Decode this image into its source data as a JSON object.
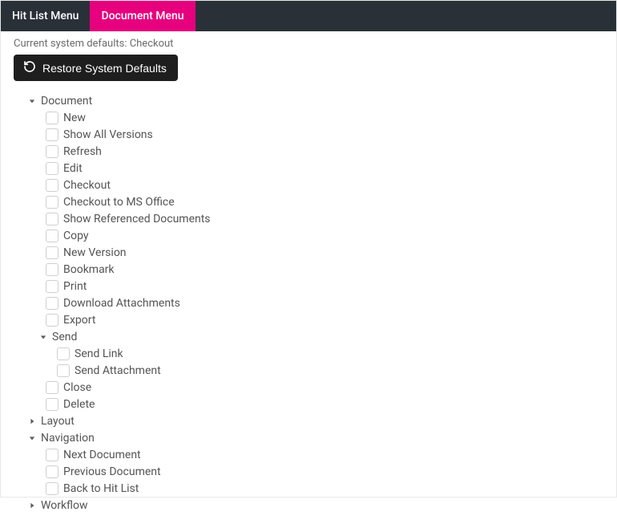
{
  "tabs": {
    "hitlist": "Hit List Menu",
    "document": "Document Menu"
  },
  "defaults_label": "Current system defaults: Checkout",
  "restore_button": "Restore System Defaults",
  "tree": {
    "document": {
      "label": "Document",
      "items": {
        "new": "New",
        "show_all_versions": "Show All Versions",
        "refresh": "Refresh",
        "edit": "Edit",
        "checkout": "Checkout",
        "checkout_ms_office": "Checkout to MS Office",
        "show_referenced": "Show Referenced Documents",
        "copy": "Copy",
        "new_version": "New Version",
        "bookmark": "Bookmark",
        "print": "Print",
        "download_attachments": "Download Attachments",
        "export": "Export"
      },
      "send": {
        "label": "Send",
        "items": {
          "send_link": "Send Link",
          "send_attachment": "Send Attachment"
        }
      },
      "after_send": {
        "close": "Close",
        "delete": "Delete"
      }
    },
    "layout": {
      "label": "Layout"
    },
    "navigation": {
      "label": "Navigation",
      "items": {
        "next_document": "Next Document",
        "previous_document": "Previous Document",
        "back_to_hit_list": "Back to Hit List"
      }
    },
    "workflow": {
      "label": "Workflow"
    }
  }
}
